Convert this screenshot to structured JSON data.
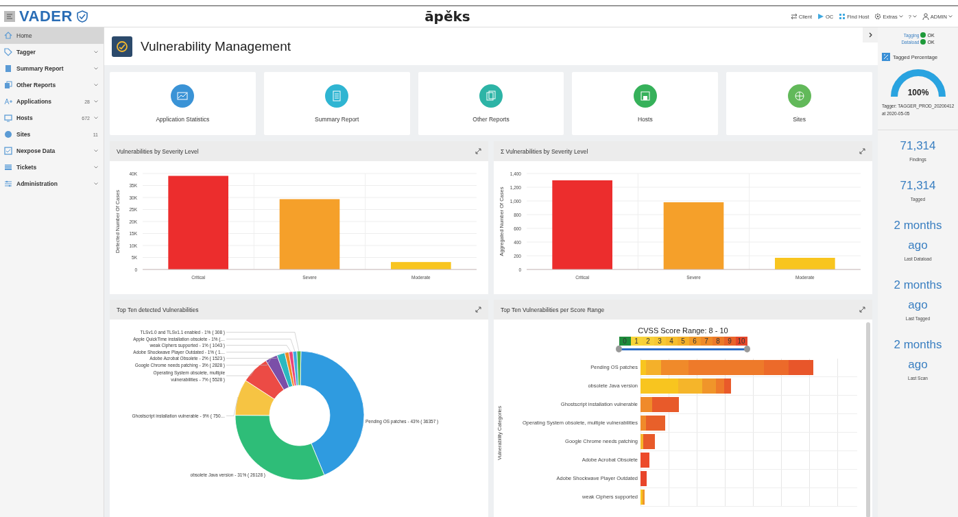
{
  "header": {
    "logo": "VADER",
    "center_logo": "āpěks",
    "actions": [
      {
        "label": "Client",
        "dropdown": false
      },
      {
        "label": "OC",
        "dropdown": false
      },
      {
        "label": "Find Host",
        "dropdown": false
      },
      {
        "label": "Extras",
        "dropdown": true
      },
      {
        "label": "?",
        "dropdown": true
      },
      {
        "label": "ADMIN",
        "dropdown": true
      }
    ]
  },
  "sidebar": {
    "items": [
      {
        "label": "Home",
        "selected": true,
        "submenu": false
      },
      {
        "label": "Tagger",
        "selected": false,
        "submenu": true
      },
      {
        "label": "Summary Report",
        "selected": false,
        "submenu": true
      },
      {
        "label": "Other Reports",
        "selected": false,
        "submenu": true
      },
      {
        "label": "Applications",
        "selected": false,
        "submenu": true,
        "badge": "28"
      },
      {
        "label": "Hosts",
        "selected": false,
        "submenu": true,
        "badge": "672"
      },
      {
        "label": "Sites",
        "selected": false,
        "submenu": false,
        "badge": "11"
      },
      {
        "label": "Nexpose Data",
        "selected": false,
        "submenu": true
      },
      {
        "label": "Tickets",
        "selected": false,
        "submenu": true
      },
      {
        "label": "Administration",
        "selected": false,
        "submenu": true
      }
    ]
  },
  "page_title": "Vulnerability Management",
  "nav_cards": [
    {
      "label": "Application Statistics",
      "color": "#3a93d6"
    },
    {
      "label": "Summary Report",
      "color": "#2fb5d2"
    },
    {
      "label": "Other Reports",
      "color": "#2db4a6"
    },
    {
      "label": "Hosts",
      "color": "#36b15a"
    },
    {
      "label": "Sites",
      "color": "#62b95a"
    }
  ],
  "panels": [
    {
      "title": "Vulnerabilities by Severity Level",
      "chart_data": {
        "type": "bar",
        "ylabel": "Detected Number Of Cases",
        "categories": [
          "Critical",
          "Severe",
          "Moderate"
        ],
        "grid": true,
        "values": [
          39000,
          29300,
          3100
        ],
        "colors": [
          "#ec2d2d",
          "#f5a02a",
          "#f8c51f"
        ],
        "ylim": [
          0,
          40000
        ],
        "yticks": [
          {
            "value": 0,
            "label": "0"
          },
          {
            "value": 5000,
            "label": "5K"
          },
          {
            "value": 10000,
            "label": "10K"
          },
          {
            "value": 15000,
            "label": "15K"
          },
          {
            "value": 20000,
            "label": "20K"
          },
          {
            "value": 25000,
            "label": "25K"
          },
          {
            "value": 30000,
            "label": "30K"
          },
          {
            "value": 35000,
            "label": "35K"
          },
          {
            "value": 40000,
            "label": "40K"
          }
        ]
      }
    },
    {
      "title": "Σ Vulnerabilities by Severity Level",
      "chart_data": {
        "type": "bar",
        "ylabel": "Aggregated Number Of Cases",
        "categories": [
          "Critical",
          "Severe",
          "Moderate"
        ],
        "grid": true,
        "values": [
          1300,
          980,
          170
        ],
        "colors": [
          "#ec2d2d",
          "#f5a02a",
          "#f8c51f"
        ],
        "ylim": [
          0,
          1400
        ],
        "yticks": [
          {
            "value": 0,
            "label": "0"
          },
          {
            "value": 200,
            "label": "200"
          },
          {
            "value": 400,
            "label": "400"
          },
          {
            "value": 600,
            "label": "600"
          },
          {
            "value": 800,
            "label": "800"
          },
          {
            "value": 1000,
            "label": "1,000"
          },
          {
            "value": 1200,
            "label": "1,200"
          },
          {
            "value": 1400,
            "label": "1,400"
          }
        ]
      }
    },
    {
      "title": "Top Ten detected Vulnerabilities",
      "chart_data": {
        "type": "donut",
        "categories": [
          "Pending OS patches - 43% ( 36357 )",
          "obsolete Java version - 31% ( 26128 )",
          "Ghostscript installation vulnerable - 9% ( 750…",
          "Operating System obsolete, multiple vulnerabilities - 7% ( 5528 )",
          "Google Chrome needs patching - 3% ( 2828 )",
          "Adobe Acrobat Obsolete - 2% ( 1523 )",
          "Adobe Shockwave Player Outdated - 1% ( 1…",
          "weak Ciphers supported - 1% ( 1043 )",
          "Apple QuickTime installation obsolete - 1% (…",
          "TLSv1.0 and TLSv1.1 enabled - 1% ( 308 )"
        ],
        "values": [
          43,
          31,
          9,
          7,
          3,
          2,
          1,
          1,
          1,
          1
        ],
        "colors": [
          "#2f9be0",
          "#2ebd78",
          "#f6c443",
          "#ec4b45",
          "#7b4fa8",
          "#2ab8c0",
          "#f08a24",
          "#e8457a",
          "#3fa9e0",
          "#4cb84c"
        ]
      }
    },
    {
      "title": "Top Ten Vulnerabilities per Score Range",
      "score_range": {
        "title": "CVSS Score Range: 8 - 10",
        "scale": [
          {
            "label": "0",
            "color": "#1e8b3a"
          },
          {
            "label": "1",
            "color": "#f7d43a"
          },
          {
            "label": "2",
            "color": "#f7d03a"
          },
          {
            "label": "3",
            "color": "#f6c834"
          },
          {
            "label": "4",
            "color": "#f5bd2e"
          },
          {
            "label": "5",
            "color": "#f4b02a"
          },
          {
            "label": "6",
            "color": "#f19a2a"
          },
          {
            "label": "7",
            "color": "#ee8a2a"
          },
          {
            "label": "8",
            "color": "#ec7a2a"
          },
          {
            "label": "9",
            "color": "#e9642a"
          },
          {
            "label": "10",
            "color": "#e4462a"
          }
        ],
        "thumbs": [
          {
            "level": 0
          },
          {
            "level": 1
          }
        ]
      },
      "axis_label": "Vulnerability Categories",
      "categories": [
        "Pending OS patches",
        "obsolete Java version",
        "Ghostscript installation vulnerable",
        "Operating System obsolete, multiple vulnerabilities",
        "Google Chrome needs patching",
        "Adobe Acrobat Obsolete",
        "Adobe Shockwave Player Outdated",
        "weak Ciphers supported"
      ]
    }
  ],
  "side_panel": {
    "status": [
      {
        "label": "Tagging",
        "value": "OK",
        "color": "#1e9a3a"
      },
      {
        "label": "Dataload",
        "value": "OK",
        "color": "#1e9a3a"
      }
    ],
    "tagged_percentage": {
      "title": "Tagged Percentage",
      "reading": "100%",
      "tagger": "Tagger: TAGGER_PROD_20200412",
      "date": "at 2020-05-05"
    },
    "stats": [
      {
        "value": "71,314",
        "label": "Findings"
      },
      {
        "value": "71,314",
        "label": "Tagged"
      },
      {
        "value": "2 months ago",
        "label": "Last Dataload"
      },
      {
        "value": "2 months ago",
        "label": "Last Tagged"
      },
      {
        "value": "2 months ago",
        "label": "Last Scan"
      }
    ]
  }
}
